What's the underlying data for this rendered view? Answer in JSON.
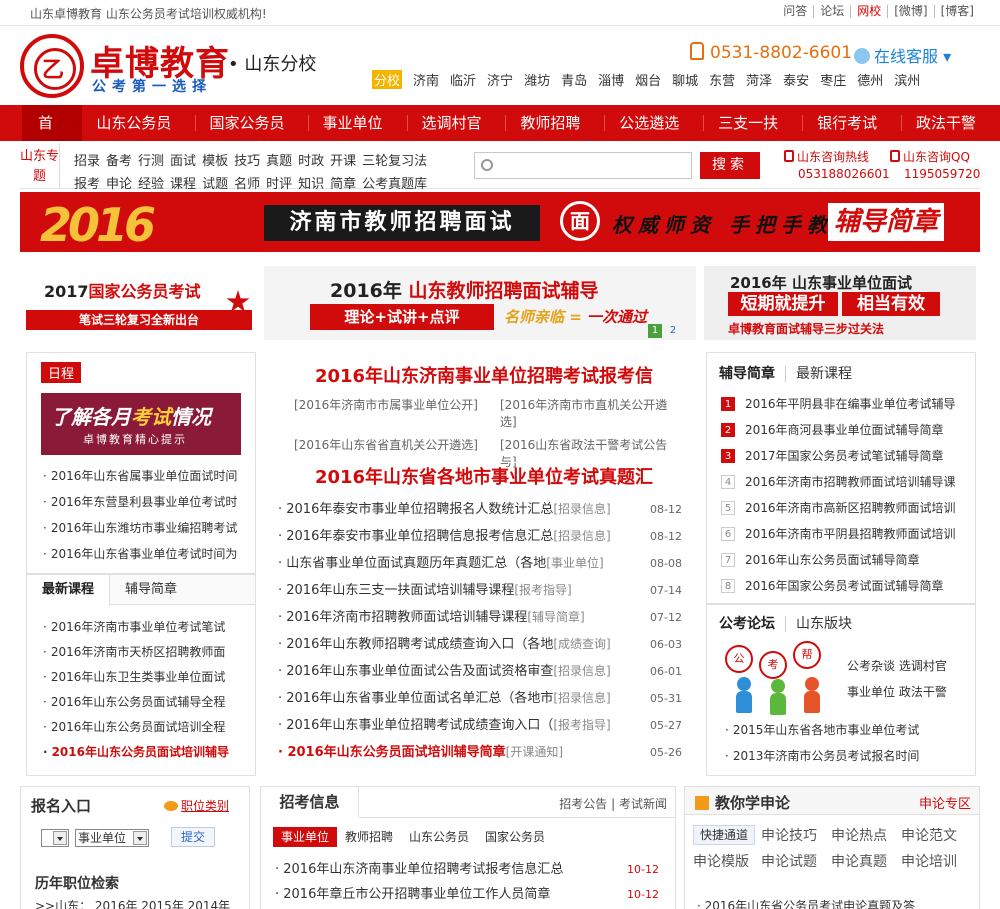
{
  "topbar": {
    "left": "山东卓博教育  山东公务员考试培训权威机构!",
    "links": [
      "问答",
      "论坛",
      "网校",
      "[微博]",
      "[博客]"
    ]
  },
  "header": {
    "seal_char": "乙",
    "brand": "卓博教育",
    "slogan": "公考第一选择",
    "branch": "• 山东分校",
    "phone": "0531-8802-6601",
    "kefu": "在线客服",
    "cities": [
      "分校",
      "济南",
      "临沂",
      "济宁",
      "潍坊",
      "青岛",
      "淄博",
      "烟台",
      "聊城",
      "东营",
      "菏泽",
      "泰安",
      "枣庄",
      "德州",
      "滨州"
    ]
  },
  "nav": {
    "home": "首页",
    "items": [
      "山东公务员",
      "国家公务员",
      "事业单位",
      "选调村官",
      "教师招聘",
      "公选遴选",
      "三支一扶",
      "银行考试",
      "政法干警"
    ]
  },
  "topics": {
    "label": "山东专题",
    "row1": [
      "招录",
      "备考",
      "行测",
      "面试",
      "模板",
      "技巧",
      "真题",
      "时政",
      "开课",
      "三轮复习法"
    ],
    "row2": [
      "报考",
      "申论",
      "经验",
      "课程",
      "试题",
      "名师",
      "时评",
      "知识",
      "简章",
      "公考真题库"
    ]
  },
  "search": {
    "placeholder": "",
    "button": "搜索"
  },
  "hotline": {
    "label": "山东咨询热线",
    "number": "053188026601"
  },
  "qq": {
    "label": "山东咨询QQ",
    "number": "1195059720"
  },
  "banner": {
    "year": "2016",
    "title": "济南市教师招聘面试",
    "circle": "面",
    "text": "权威师资 手把手教",
    "tag": "辅导简章"
  },
  "ads": {
    "a1": {
      "year": "2017",
      "title": "国家公务员考试",
      "sub": "笔试三轮复习全新出台"
    },
    "a2": {
      "year": "2016年",
      "title": "山东教师招聘面试辅导",
      "sub": "理论+试讲+点评",
      "s1": "名师亲临",
      "s2": "一次通过",
      "n1": "1",
      "n2": "2"
    },
    "a3": {
      "title": "2016年 山东事业单位面试",
      "b1": "短期就提升",
      "b2": "相当有效",
      "foot": "卓博教育面试辅导三步过关法"
    }
  },
  "schedule": {
    "tag": "日程",
    "pic_title_a": "了解各月",
    "pic_title_b": "考试",
    "pic_title_c": "情况",
    "pic_sub": "卓博教育精心提示",
    "items": [
      "2016年山东省属事业单位面试时间",
      "2016年东营垦利县事业单位考试时",
      "2016年山东潍坊市事业编招聘考试",
      "2016年山东省事业单位考试时间为"
    ]
  },
  "courses": {
    "tabs": [
      "最新课程",
      "辅导简章"
    ],
    "items": [
      "2016年济南市事业单位考试笔试",
      "2016年济南市天桥区招聘教师面",
      "2016年山东卫生类事业单位面试",
      "2016年山东公务员面试辅导全程",
      "2016年山东公务员面试培训全程"
    ],
    "highlight": "2016年山东公务员面试培训辅导"
  },
  "center": {
    "headline1": "2016年山东济南事业单位招聘考试报考信",
    "tags": [
      "[2016年济南市市属事业单位公开]",
      "[2016年济南市市直机关公开遴选]",
      "[2016年山东省省直机关公开遴选]",
      "[2016山东省政法干警考试公告与]"
    ],
    "headline2": "2016年山东省各地市事业单位考试真题汇",
    "news": [
      {
        "t": "2016年泰安市事业单位招聘报名人数统计汇总",
        "c": "[招录信息]",
        "d": "08-12"
      },
      {
        "t": "2016年泰安市事业单位招聘信息报考信息汇总",
        "c": "[招录信息]",
        "d": "08-12"
      },
      {
        "t": "山东省事业单位面试真题历年真题汇总（各地",
        "c": "[事业单位]",
        "d": "08-08"
      },
      {
        "t": "2016年山东三支一扶面试培训辅导课程",
        "c": "[报考指导]",
        "d": "07-14"
      },
      {
        "t": "2016年济南市招聘教师面试培训辅导课程",
        "c": "[辅导简章]",
        "d": "07-12"
      },
      {
        "t": "2016年山东教师招聘考试成绩查询入口（各地",
        "c": "[成绩查询]",
        "d": "06-03"
      },
      {
        "t": "2016年山东事业单位面试公告及面试资格审查",
        "c": "[招录信息]",
        "d": "06-01"
      },
      {
        "t": "2016年山东省事业单位面试名单汇总（各地市",
        "c": "[招录信息]",
        "d": "05-31"
      },
      {
        "t": "2016年山东事业单位招聘考试成绩查询入口（",
        "c": "[报考指导]",
        "d": "05-27"
      },
      {
        "t": "2016年山东公务员面试培训辅导简章",
        "c": "[开课通知]",
        "d": "05-26"
      }
    ]
  },
  "guide": {
    "tabs": [
      "辅导简章",
      "最新课程"
    ],
    "items": [
      "2016年平阴县非在编事业单位考试辅导",
      "2016年商河县事业单位面试辅导简章",
      "2017年国家公务员考试笔试辅导简章",
      "2016年济南市招聘教师面试培训辅导课",
      "2016年济南市高新区招聘教师面试培训",
      "2016年济南市平阴县招聘教师面试培训",
      "2016年山东公务员面试辅导简章",
      "2016年国家公务员考试面试辅导简章"
    ],
    "nums": [
      "1",
      "2",
      "3",
      "4",
      "5",
      "6",
      "7",
      "8"
    ]
  },
  "forum": {
    "tabs": [
      "公考论坛",
      "山东版块"
    ],
    "bubbles": [
      "公",
      "考",
      "帮"
    ],
    "cats": [
      "公考杂谈",
      "选调村官",
      "事业单位",
      "政法干警"
    ],
    "items": [
      "2015年山东省各地市事业单位考试",
      "2013年济南市公务员考试报名时间"
    ]
  },
  "apply": {
    "title": "报名入口",
    "cat": "职位类别",
    "select": "事业单位",
    "submit": "提交",
    "title2": "历年职位检索",
    "years": ">>山东：  2016年  2015年  2014年"
  },
  "exam": {
    "title": "招考信息",
    "more": [
      "招考公告",
      "考试新闻"
    ],
    "tabs": [
      "事业单位",
      "教师招聘",
      "山东公务员",
      "国家公务员"
    ],
    "news": [
      {
        "t": "2016年山东济南事业单位招聘考试报考信息汇总",
        "d": "10-12"
      },
      {
        "t": "2016年章丘市公开招聘事业单位工作人员简章",
        "d": "10-12"
      }
    ]
  },
  "essay": {
    "title": "教你学申论",
    "zone": "申论专区",
    "fast": "快捷通道",
    "links": [
      "申论技巧",
      "申论热点",
      "申论范文",
      "申论模版",
      "申论试题",
      "申论真题",
      "申论培训"
    ],
    "last": "· 2016年山东省公务员考试申论真题及答"
  },
  "colors": {
    "brand_red": "#d10b0b",
    "accent_orange": "#e46f10",
    "link_blue": "#1a83d8"
  }
}
